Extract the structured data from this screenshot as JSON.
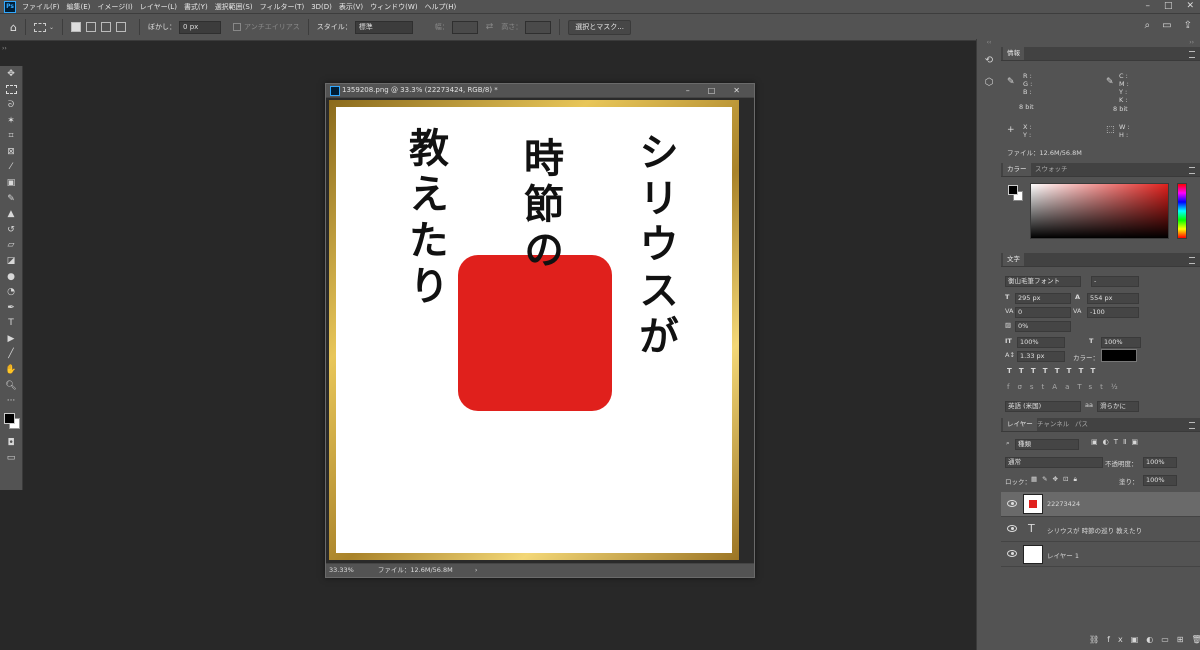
{
  "menu": [
    "ファイル(F)",
    "編集(E)",
    "イメージ(I)",
    "レイヤー(L)",
    "書式(Y)",
    "選択範囲(S)",
    "フィルター(T)",
    "3D(D)",
    "表示(V)",
    "ウィンドウ(W)",
    "ヘルプ(H)"
  ],
  "options": {
    "feather_label": "ぼかし：",
    "feather_value": "0 px",
    "antialias_label": "アンチエイリアス",
    "style_label": "スタイル：",
    "style_value": "標準",
    "width_label": "幅：",
    "height_label": "高さ：",
    "select_mask_button": "選択とマスク..."
  },
  "document": {
    "title": "1359208.png @ 33.3% (22273424, RGB/8) *",
    "zoom": "33.33%",
    "file_info": "ファイル：12.6M/56.8M",
    "poem_col1": "シリウスが",
    "poem_col2": "時節の",
    "poem_col3": "教えたり",
    "seal_color": "#e0201c"
  },
  "panels": {
    "info": {
      "tab": "情報",
      "rgb": [
        "R :",
        "G :",
        "B :"
      ],
      "cmyk": [
        "C :",
        "M :",
        "Y :",
        "K :"
      ],
      "bit_left": "8 bit",
      "bit_right": "8 bit",
      "xy": [
        "X :",
        "Y :"
      ],
      "wh": [
        "W :",
        "H :"
      ],
      "file": "ファイル：12.6M/56.8M"
    },
    "color": {
      "tabs": [
        "カラー",
        "スウォッチ"
      ]
    },
    "character": {
      "tab": "文字",
      "font": "衡山毛筆フォント",
      "style": "-",
      "size": "295 px",
      "leading": "554 px",
      "kerning": "0",
      "tracking": "-100",
      "tsume": "0%",
      "vscale": "100%",
      "hscale": "100%",
      "baseline": "1.33 px",
      "color_label": "カラー：",
      "language": "英語 (米国)",
      "antialias": "滑らかに"
    },
    "layers": {
      "tabs": [
        "レイヤー",
        "チャンネル",
        "パス"
      ],
      "filter": "種類",
      "blend": "通常",
      "opacity_label": "不透明度：",
      "opacity": "100%",
      "lock_label": "ロック：",
      "fill_label": "塗り：",
      "fill": "100%",
      "items": [
        "22273424",
        "シリウスが 時節の巡り 教えたり",
        "レイヤー 1"
      ]
    }
  },
  "colors": {
    "accent": "#31a8ff",
    "frame_gold": "#e8c659"
  }
}
